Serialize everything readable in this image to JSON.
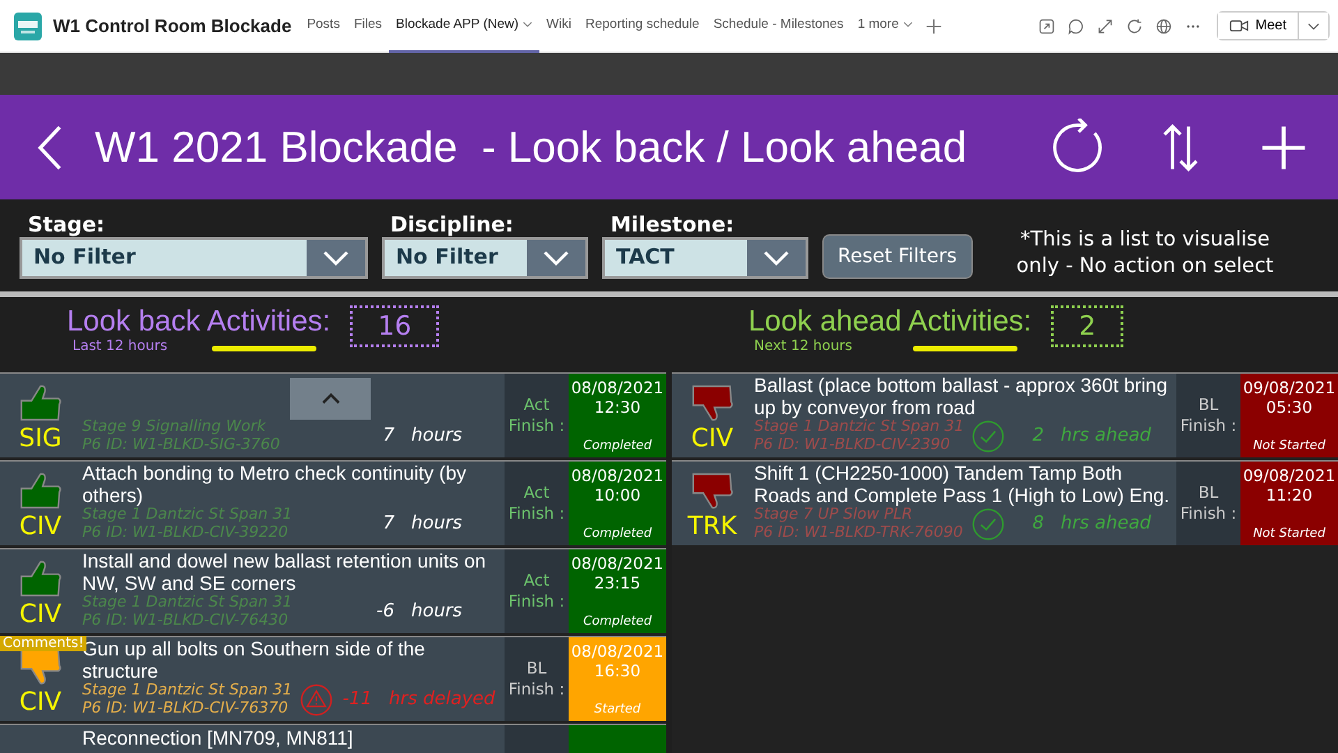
{
  "teams_header": {
    "channel_title": "W1 Control Room Blockade",
    "tabs": [
      {
        "label": "Posts",
        "selected": false,
        "dropdown": false
      },
      {
        "label": "Files",
        "selected": false,
        "dropdown": false
      },
      {
        "label": "Blockade APP (New)",
        "selected": true,
        "dropdown": true
      },
      {
        "label": "Wiki",
        "selected": false,
        "dropdown": false
      },
      {
        "label": "Reporting schedule",
        "selected": false,
        "dropdown": false
      },
      {
        "label": "Schedule - Milestones",
        "selected": false,
        "dropdown": false
      },
      {
        "label": "1 more",
        "selected": false,
        "dropdown": true
      }
    ],
    "meet_label": "Meet"
  },
  "banner": {
    "title": "W1 2021 Blockade  - Look back / Look ahead"
  },
  "filters": [
    {
      "label": "Stage:",
      "value": "No Filter"
    },
    {
      "label": "Discipline:",
      "value": "No Filter"
    },
    {
      "label": "Milestone:",
      "value": "TACT"
    }
  ],
  "reset_button": "Reset Filters",
  "note": "*This is a list to visualise only - No action on select",
  "look_back": {
    "heading": "Look back Activities:",
    "subheading": "Last 12 hours",
    "count": "16"
  },
  "look_ahead": {
    "heading": "Look ahead Activities:",
    "subheading": "Next 12 hours",
    "count": "2"
  },
  "look_back_items": [
    {
      "kind": "thumbs_up",
      "color": "#006400",
      "discipline": "SIG",
      "stage": "Stage 9 Signalling Work",
      "p6_id": "P6 ID:  W1-BLKD-SIG-3760",
      "variance": {
        "kind": "plain",
        "value": "7",
        "unit": "hours"
      },
      "finish_label": "Act Finish :",
      "date": "08/08/2021",
      "time": "12:30",
      "status": "Completed"
    },
    {
      "kind": "thumbs_up",
      "color": "#006400",
      "discipline": "CIV",
      "title": "Attach bonding to Metro check continuity (by others)",
      "stage": "Stage 1 Dantzic St Span 31",
      "p6_id": "P6 ID:  W1-BLKD-CIV-39220",
      "variance": {
        "kind": "plain",
        "value": "7",
        "unit": "hours"
      },
      "finish_label": "Act Finish :",
      "date": "08/08/2021",
      "time": "10:00",
      "status": "Completed"
    },
    {
      "kind": "thumbs_up",
      "color": "#006400",
      "discipline": "CIV",
      "title": "Install and dowel new ballast retention units on NW, SW and SE corners",
      "stage": "Stage 1 Dantzic St Span 31",
      "p6_id": "P6 ID:  W1-BLKD-CIV-76430",
      "variance": {
        "kind": "plain",
        "value": "-6",
        "unit": "hours"
      },
      "finish_label": "Act Finish :",
      "date": "08/08/2021",
      "time": "23:15",
      "status": "Completed"
    },
    {
      "kind": "thumbs_down",
      "color": "#ffa500",
      "discipline": "CIV",
      "title": "Gun up all bolts on Southern side of the structure",
      "stage": "Stage 1 Dantzic St Span 31",
      "p6_id": "P6 ID:  W1-BLKD-CIV-76370",
      "variance": {
        "kind": "delayed",
        "value": "-11",
        "unit": "hrs delayed"
      },
      "finish_label": "BL Finish :",
      "date": "08/08/2021",
      "time": "16:30",
      "status": "Started",
      "comment": "Comments!"
    },
    {
      "kind": "blank",
      "color": "#006400",
      "title": "Reconnection [MN709, MN811]"
    }
  ],
  "look_ahead_items": [
    {
      "kind": "thumbs_down",
      "color": "#8b0000",
      "discipline": "CIV",
      "title": "Ballast (place bottom ballast - approx 360t bring up by conveyor from road",
      "stage": "Stage 1 Dantzic St Span 31",
      "p6_id": "P6 ID:  W1-BLKD-CIV-2390",
      "variance": {
        "kind": "ahead",
        "value": "2",
        "unit": "hrs ahead"
      },
      "finish_label": "BL Finish :",
      "date": "09/08/2021",
      "time": "05:30",
      "status": "Not Started"
    },
    {
      "kind": "thumbs_down",
      "color": "#8b0000",
      "discipline": "TRK",
      "title": "Shift 1 (CH2250-1000) Tandem Tamp Both Roads and Complete Pass 1 (High to Low) Eng.",
      "stage": "Stage 7 UP Slow PLR",
      "p6_id": "P6 ID:  W1-BLKD-TRK-76090",
      "variance": {
        "kind": "ahead",
        "value": "8",
        "unit": "hrs ahead"
      },
      "finish_label": "BL Finish :",
      "date": "09/08/2021",
      "time": "11:20",
      "status": "Not Started"
    }
  ]
}
